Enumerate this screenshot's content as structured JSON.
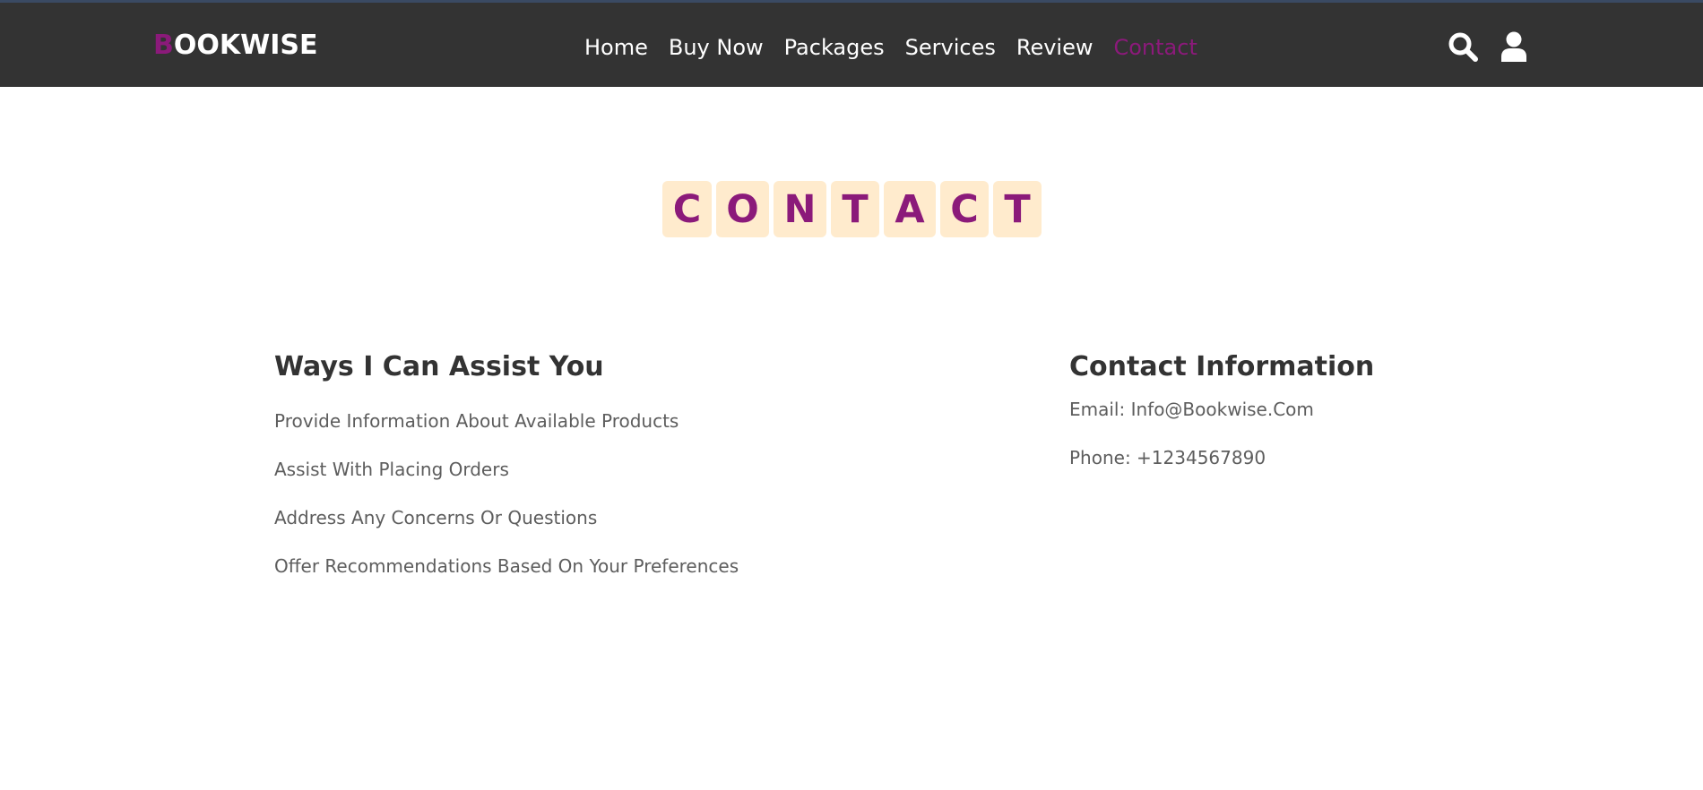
{
  "header": {
    "logo_first_letter": "B",
    "logo_rest": "OOKWISE",
    "nav": [
      "Home",
      "Buy Now",
      "Packages",
      "Services",
      "Review",
      "Contact"
    ],
    "active_nav": "Contact",
    "icons": [
      "search-icon",
      "user-icon"
    ]
  },
  "heading": {
    "letters": [
      "C",
      "O",
      "N",
      "T",
      "A",
      "C",
      "T"
    ]
  },
  "assist": {
    "title": "Ways I Can Assist You",
    "items": [
      "Provide Information About Available Products",
      "Assist With Placing Orders",
      "Address Any Concerns Or Questions",
      "Offer Recommendations Based On Your Preferences"
    ]
  },
  "contact": {
    "title": "Contact Information",
    "email": "Email: Info@Bookwise.Com",
    "phone": "Phone: +1234567890"
  },
  "colors": {
    "navbar_bg": "#333333",
    "accent": "#8b1a7a",
    "tile_bg": "#ffebcd",
    "text_dark": "#333333",
    "text_muted": "#5d5d5d"
  }
}
